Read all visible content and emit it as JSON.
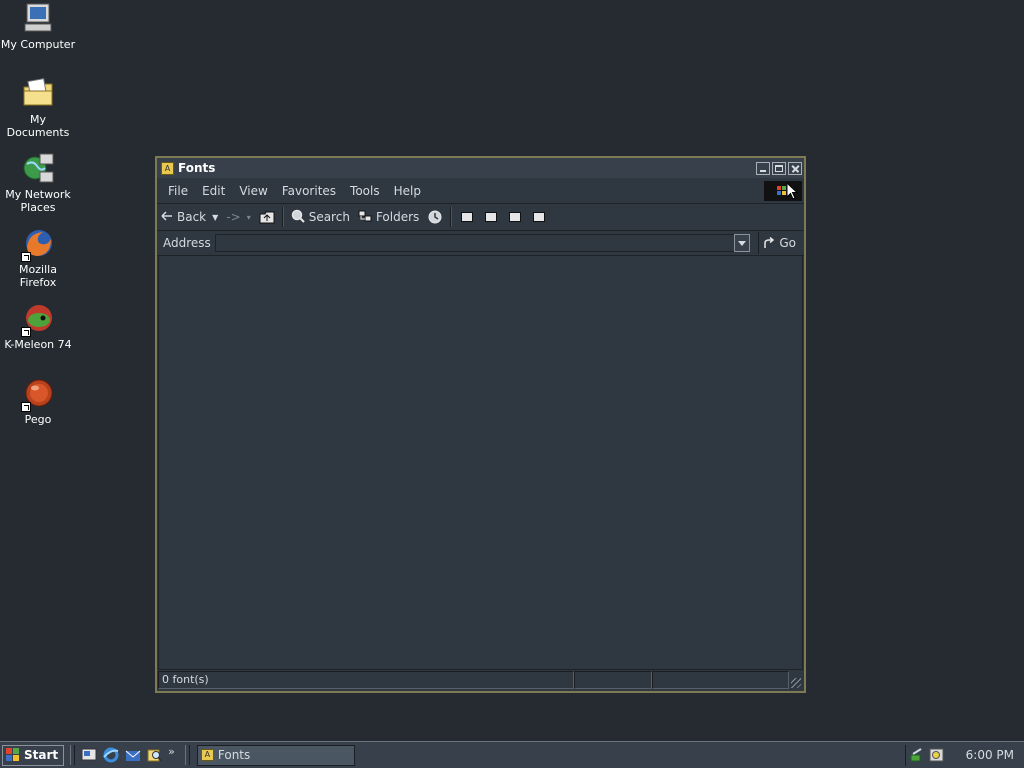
{
  "desktop": {
    "icons": [
      {
        "label": "My Computer",
        "icon": "my-computer-icon"
      },
      {
        "label": "My Documents",
        "icon": "my-documents-icon"
      },
      {
        "label": "My Network Places",
        "icon": "network-places-icon"
      },
      {
        "label": "Mozilla Firefox",
        "icon": "firefox-icon"
      },
      {
        "label": "K-Meleon 74",
        "icon": "k-meleon-icon"
      },
      {
        "label": "Pego",
        "icon": "pego-icon"
      }
    ]
  },
  "window": {
    "title": "Fonts",
    "menu": [
      "File",
      "Edit",
      "View",
      "Favorites",
      "Tools",
      "Help"
    ],
    "toolbar": {
      "back_label": "Back",
      "search_label": "Search",
      "folders_label": "Folders"
    },
    "address": {
      "label": "Address",
      "value": "",
      "go_label": "Go"
    },
    "status": {
      "text": "0 font(s)"
    }
  },
  "taskbar": {
    "start_label": "Start",
    "task_label": "Fonts",
    "clock": "6:00 PM"
  }
}
